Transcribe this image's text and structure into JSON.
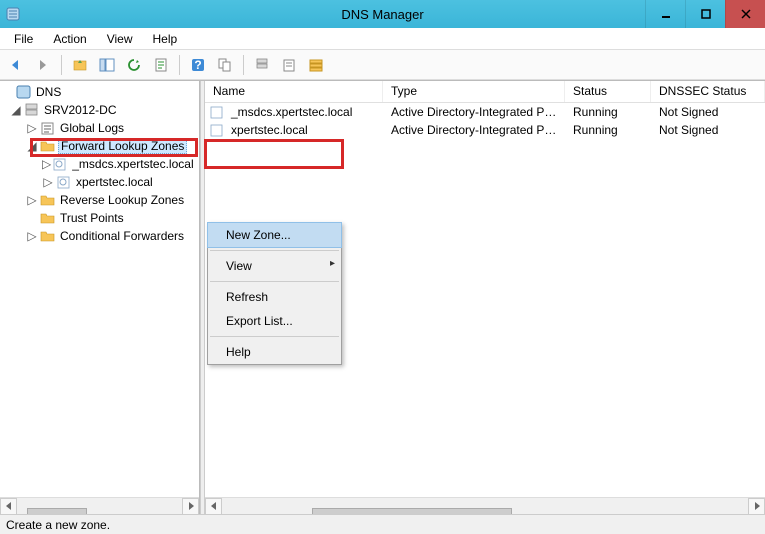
{
  "title": "DNS Manager",
  "menubar": [
    "File",
    "Action",
    "View",
    "Help"
  ],
  "tree": {
    "root": "DNS",
    "server": "SRV2012-DC",
    "nodes": {
      "global_logs": "Global Logs",
      "forward_lookup": "Forward Lookup Zones",
      "msdcs": "_msdcs.xpertstec.local",
      "xperts": "xpertstec.local",
      "reverse_lookup": "Reverse Lookup Zones",
      "trust_points": "Trust Points",
      "conditional": "Conditional Forwarders"
    }
  },
  "columns": {
    "name": "Name",
    "type": "Type",
    "status": "Status",
    "dnssec": "DNSSEC Status"
  },
  "rows": [
    {
      "name": "_msdcs.xpertstec.local",
      "type": "Active Directory-Integrated Pr...",
      "status": "Running",
      "dnssec": "Not Signed"
    },
    {
      "name": "xpertstec.local",
      "type": "Active Directory-Integrated Pr...",
      "status": "Running",
      "dnssec": "Not Signed"
    }
  ],
  "context_menu": {
    "new_zone": "New Zone...",
    "view": "View",
    "refresh": "Refresh",
    "export": "Export List...",
    "help": "Help"
  },
  "statusbar": "Create a new zone."
}
